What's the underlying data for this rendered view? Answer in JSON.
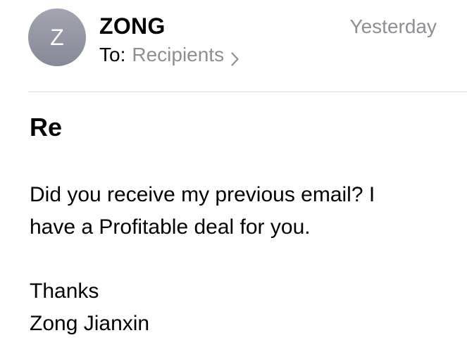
{
  "header": {
    "avatar_initial": "Z",
    "sender_name": "ZONG",
    "date": "Yesterday",
    "to_label": "To:",
    "recipients_label": "Recipients",
    "chevron_icon": "chevron-right-icon"
  },
  "message": {
    "subject": "Re",
    "body_line_1": "Did you receive my previous email? I",
    "body_line_2": "have a Profitable deal for you.",
    "closing": "Thanks",
    "signature": "Zong Jianxin"
  },
  "colors": {
    "secondary_text": "#8e8e93",
    "avatar": "#8e919c",
    "divider": "#d8d8dc"
  }
}
